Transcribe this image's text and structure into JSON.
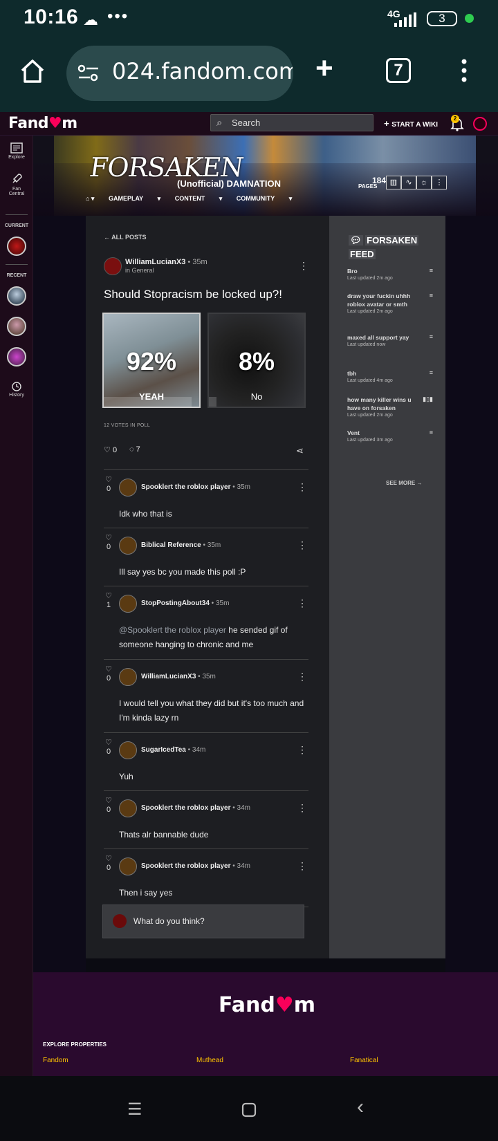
{
  "statusbar": {
    "time": "10:16",
    "network": "4G",
    "battery": "3",
    "cloud_icon": "cloud-icon",
    "more_icon": "more-dots-icon"
  },
  "browser": {
    "url": "024.fandom.com",
    "tab_count": "7"
  },
  "fandom_nav": {
    "logo_pre": "Fand",
    "logo_post": "m",
    "search_placeholder": "Search",
    "start_wiki": "START A WIKI",
    "notif_count": "2"
  },
  "siderail": {
    "explore": "Explore",
    "fan_central_1": "Fan",
    "fan_central_2": "Central",
    "current": "CURRENT",
    "recent": "RECENT",
    "history": "History"
  },
  "wiki": {
    "logo_text": "FORSAKEN",
    "name": "(Unofficial) DAMNATION",
    "pages_count": "184",
    "pages_label": "PAGES",
    "nav": [
      "GAMEPLAY",
      "CONTENT",
      "COMMUNITY"
    ]
  },
  "post": {
    "back_label": "ALL POSTS",
    "author": "WilliamLucianX3",
    "time": "35m",
    "category": "in General",
    "title": "Should Stopracism be locked up?!",
    "poll": [
      {
        "label": "YEAH",
        "percent": "92%",
        "share": 0.92
      },
      {
        "label": "No",
        "percent": "8%",
        "share": 0.08
      }
    ],
    "votes": "12 VOTES IN POLL",
    "likes": "0",
    "comments": "7"
  },
  "replies": [
    {
      "author": "Spooklert the roblox player",
      "time": "35m",
      "likes": "0",
      "text": "Idk who that is"
    },
    {
      "author": "Biblical Reference",
      "time": "35m",
      "likes": "0",
      "text": "Ill say yes bc you made this poll :P"
    },
    {
      "author": "StopPostingAbout34",
      "time": "35m",
      "likes": "1",
      "mention": "@Spooklert the roblox player",
      "text": " he sended gif of someone hanging to chronic and me"
    },
    {
      "author": "WilliamLucianX3",
      "time": "35m",
      "likes": "0",
      "text": "I would tell you what they did but it's too much and I'm kinda lazy rn"
    },
    {
      "author": "SugarIcedTea",
      "time": "34m",
      "likes": "0",
      "text": "Yuh"
    },
    {
      "author": "Spooklert the roblox player",
      "time": "34m",
      "likes": "0",
      "text": "Thats alr bannable dude"
    },
    {
      "author": "Spooklert the roblox player",
      "time": "34m",
      "likes": "0",
      "text": "Then i say yes"
    }
  ],
  "composer": {
    "placeholder": "What do you think?"
  },
  "feed": {
    "title_1": "FORSAKEN",
    "title_2": "FEED",
    "items": [
      {
        "title": "Bro",
        "updated": "Last updated 2m ago"
      },
      {
        "title": "draw your fuckin uhhh roblox avatar or smth",
        "updated": "Last updated 2m ago"
      },
      {
        "title": "maxed all support yay",
        "updated": "Last updated now"
      },
      {
        "title": "tbh",
        "updated": "Last updated 4m ago"
      },
      {
        "title": "how many killer wins u have on forsaken",
        "updated": "Last updated 2m ago"
      },
      {
        "title": "Vent",
        "updated": "Last updated 3m ago"
      }
    ],
    "see_more": "SEE MORE"
  },
  "footer": {
    "logo_pre": "Fand",
    "logo_post": "m",
    "explore": "EXPLORE PROPERTIES",
    "links": [
      "Fandom",
      "Muthead",
      "Fanatical"
    ]
  },
  "colors": {
    "accent": "#fa005a",
    "link": "#ffc500",
    "chrome": "#0e2a2c",
    "footer": "#2a0a2e"
  }
}
